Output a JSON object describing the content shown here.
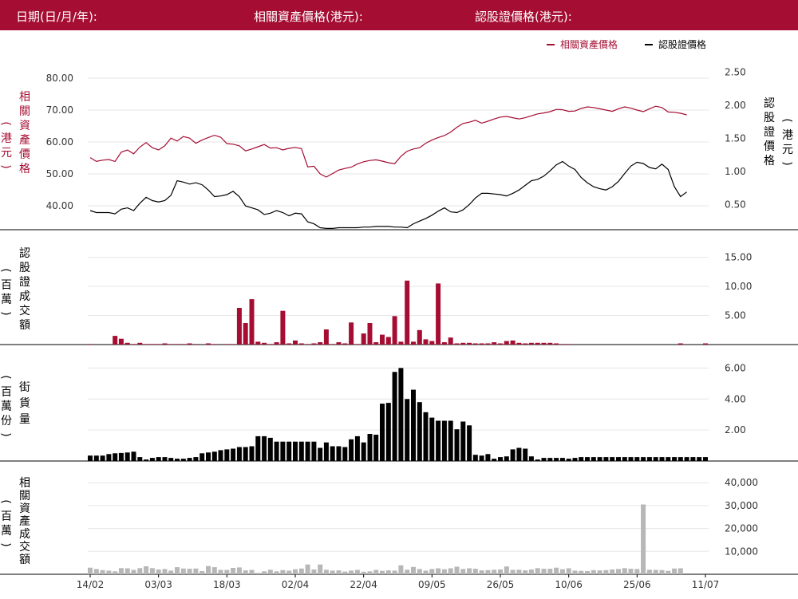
{
  "header": {
    "date_label": "日期(日/月/年):",
    "underlying_label": "相關資產價格(港元):",
    "warrant_label": "認股證價格(港元):"
  },
  "legend": {
    "underlying": "相關資產價格",
    "warrant": "認股證價格"
  },
  "colors": {
    "header_bg": "#a50d32",
    "underlying": "#a50d32",
    "warrant": "#000000",
    "underlying_turnover": "#b7b7b7",
    "grid": "#e6e6e6"
  },
  "chart_data": [
    {
      "type": "line",
      "panel": "price",
      "series": [
        {
          "name": "相關資產價格",
          "axis": "left",
          "values": [
            55.1,
            53.9,
            54.3,
            54.5,
            53.9,
            56.8,
            57.5,
            56.3,
            58.4,
            59.8,
            58.2,
            57.5,
            58.8,
            61.2,
            60.3,
            61.7,
            61.2,
            59.6,
            60.6,
            61.4,
            62.1,
            61.5,
            59.5,
            59.3,
            58.8,
            57.2,
            57.8,
            58.5,
            59.2,
            58.1,
            58.2,
            57.5,
            58.0,
            58.3,
            57.9,
            52.2,
            52.4,
            50.0,
            49.0,
            50.1,
            51.2,
            51.7,
            52.1,
            53.1,
            53.8,
            54.2,
            54.4,
            54.0,
            53.5,
            53.2,
            55.5,
            57.1,
            57.8,
            58.2,
            59.6,
            60.6,
            61.4,
            62.0,
            63.1,
            64.6,
            65.8,
            66.2,
            66.8,
            65.9,
            66.5,
            67.2,
            67.8,
            68.0,
            67.6,
            67.2,
            67.6,
            68.2,
            68.8,
            69.1,
            69.5,
            70.2,
            70.1,
            69.6,
            69.7,
            70.5,
            71.0,
            70.8,
            70.4,
            70.0,
            69.6,
            70.4,
            71.0,
            70.6,
            70.0,
            69.5,
            70.4,
            71.2,
            70.8,
            69.4,
            69.3,
            69.0,
            68.5
          ]
        },
        {
          "name": "認股證價格",
          "axis": "right",
          "values": [
            0.41,
            0.38,
            0.38,
            0.38,
            0.36,
            0.43,
            0.45,
            0.41,
            0.52,
            0.61,
            0.56,
            0.54,
            0.56,
            0.64,
            0.86,
            0.84,
            0.81,
            0.83,
            0.8,
            0.72,
            0.62,
            0.63,
            0.65,
            0.7,
            0.62,
            0.48,
            0.45,
            0.42,
            0.35,
            0.37,
            0.41,
            0.38,
            0.33,
            0.37,
            0.36,
            0.24,
            0.21,
            0.15,
            0.14,
            0.14,
            0.15,
            0.15,
            0.15,
            0.15,
            0.16,
            0.16,
            0.17,
            0.17,
            0.17,
            0.16,
            0.16,
            0.15,
            0.21,
            0.25,
            0.29,
            0.34,
            0.4,
            0.45,
            0.39,
            0.38,
            0.42,
            0.5,
            0.6,
            0.67,
            0.67,
            0.66,
            0.65,
            0.63,
            0.67,
            0.72,
            0.79,
            0.86,
            0.88,
            0.93,
            1.01,
            1.1,
            1.15,
            1.08,
            1.03,
            0.91,
            0.83,
            0.77,
            0.74,
            0.72,
            0.77,
            0.85,
            0.97,
            1.08,
            1.14,
            1.12,
            1.06,
            1.04,
            1.11,
            1.03,
            0.77,
            0.62,
            0.69
          ]
        }
      ],
      "ylim_left": [
        30,
        85
      ],
      "ylim_right": [
        0,
        2.65
      ],
      "yticks_left": [
        "80.00",
        "70.00",
        "60.00",
        "50.00",
        "40.00"
      ],
      "yticks_right": [
        "2.50",
        "2.00",
        "1.50",
        "1.00",
        "0.50"
      ],
      "ylabel_left": "（港元）相關資產價格",
      "ylabel_right": "認股證價格（港元）",
      "legend_position": "top-right"
    },
    {
      "type": "bar",
      "panel": "warrant_turnover",
      "series": [
        {
          "name": "認股證成交額",
          "values": [
            0.1,
            0,
            0,
            0,
            1.5,
            1.0,
            0.3,
            0.1,
            0.3,
            0.1,
            0.1,
            0.1,
            0.2,
            0.1,
            0.1,
            0.1,
            0.2,
            0.1,
            0,
            0.2,
            0.1,
            0,
            0.1,
            0.1,
            6.3,
            3.7,
            7.8,
            0.5,
            0.3,
            0.1,
            0.4,
            5.8,
            0.2,
            0.7,
            0.2,
            0.1,
            0.2,
            0.4,
            2.6,
            0.1,
            0.4,
            0.2,
            3.8,
            0.1,
            1.9,
            3.7,
            0.4,
            1.7,
            1.3,
            4.9,
            0.5,
            11.0,
            0.5,
            2.5,
            0.9,
            0.6,
            10.5,
            0.4,
            1.2,
            0.2,
            0.3,
            0.3,
            0.2,
            0.2,
            0.2,
            0.4,
            0.2,
            0.6,
            0.7,
            0.3,
            0.2,
            0.3,
            0.3,
            0.3,
            0.3,
            0.2,
            0.1,
            0.1,
            0,
            0,
            0,
            0,
            0,
            0,
            0,
            0,
            0,
            0,
            0,
            0,
            0,
            0,
            0,
            0,
            0,
            0.2,
            0,
            0,
            0,
            0.2
          ]
        }
      ],
      "ylim": [
        0,
        17
      ],
      "yticks": [
        "15.00",
        "10.00",
        "5.00"
      ],
      "ylabel": "（百萬）認股證成交額"
    },
    {
      "type": "bar",
      "panel": "outstanding",
      "series": [
        {
          "name": "街貨量",
          "values": [
            0.35,
            0.35,
            0.35,
            0.45,
            0.5,
            0.52,
            0.55,
            0.6,
            0.25,
            0.1,
            0.2,
            0.25,
            0.25,
            0.2,
            0.15,
            0.15,
            0.2,
            0.25,
            0.5,
            0.55,
            0.6,
            0.7,
            0.75,
            0.8,
            0.9,
            0.9,
            0.95,
            1.6,
            1.6,
            1.5,
            1.25,
            1.25,
            1.25,
            1.25,
            1.25,
            1.25,
            1.25,
            0.85,
            1.2,
            0.95,
            0.95,
            0.9,
            1.4,
            1.6,
            1.2,
            1.75,
            1.7,
            3.7,
            3.75,
            5.75,
            6.0,
            4.0,
            4.6,
            3.8,
            3.15,
            2.8,
            2.6,
            2.6,
            2.6,
            2.05,
            2.55,
            2.3,
            0.4,
            0.35,
            0.45,
            0.15,
            0.25,
            0.3,
            0.75,
            0.85,
            0.8,
            0.3,
            0.1,
            0.2,
            0.2,
            0.2,
            0.2,
            0.15,
            0.2,
            0.25,
            0.25,
            0.25,
            0.25,
            0.25,
            0.25,
            0.25,
            0.25,
            0.25,
            0.25,
            0.25,
            0.25,
            0.25,
            0.25,
            0.25,
            0.25,
            0.25,
            0.25,
            0.25,
            0.25,
            0.25
          ]
        }
      ],
      "ylim": [
        0,
        7
      ],
      "yticks": [
        "6.00",
        "4.00",
        "2.00"
      ],
      "ylabel": "（百萬份）街貨量"
    },
    {
      "type": "bar",
      "panel": "underlying_turnover",
      "series": [
        {
          "name": "相關資產成交額",
          "values": [
            2900,
            2300,
            1800,
            1600,
            1300,
            2700,
            2600,
            1900,
            2700,
            3500,
            2700,
            2100,
            2300,
            1600,
            3100,
            2500,
            2400,
            2500,
            1400,
            3600,
            3100,
            1900,
            1900,
            2800,
            3000,
            1700,
            1900,
            600,
            1300,
            2000,
            1300,
            1800,
            1600,
            2200,
            2500,
            4300,
            2100,
            4300,
            2000,
            1600,
            1700,
            1200,
            1600,
            1900,
            1100,
            1300,
            1900,
            1500,
            1700,
            1600,
            3900,
            2000,
            3200,
            2300,
            1600,
            2300,
            2600,
            2200,
            2600,
            3300,
            2300,
            2600,
            2400,
            1700,
            1800,
            2000,
            2100,
            3400,
            1900,
            2000,
            1700,
            2100,
            2700,
            2400,
            2400,
            2900,
            2200,
            2600,
            1600,
            1500,
            1400,
            1800,
            1700,
            1800,
            2100,
            2300,
            2700,
            2400,
            2300,
            30500,
            2000,
            1900,
            1800,
            1500,
            2500,
            2600
          ]
        }
      ],
      "ylim": [
        0,
        46000
      ],
      "yticks": [
        "40,000",
        "30,000",
        "20,000",
        "10,000"
      ],
      "ylabel": "（百萬）相關資產成交額"
    }
  ],
  "x_axis": {
    "tick_labels": [
      "14/02",
      "03/03",
      "18/03",
      "02/04",
      "22/04",
      "09/05",
      "26/05",
      "10/06",
      "25/06",
      "11/07"
    ],
    "tick_index": [
      0,
      11,
      22,
      33,
      44,
      55,
      66,
      77,
      88,
      99
    ],
    "count": 100
  }
}
